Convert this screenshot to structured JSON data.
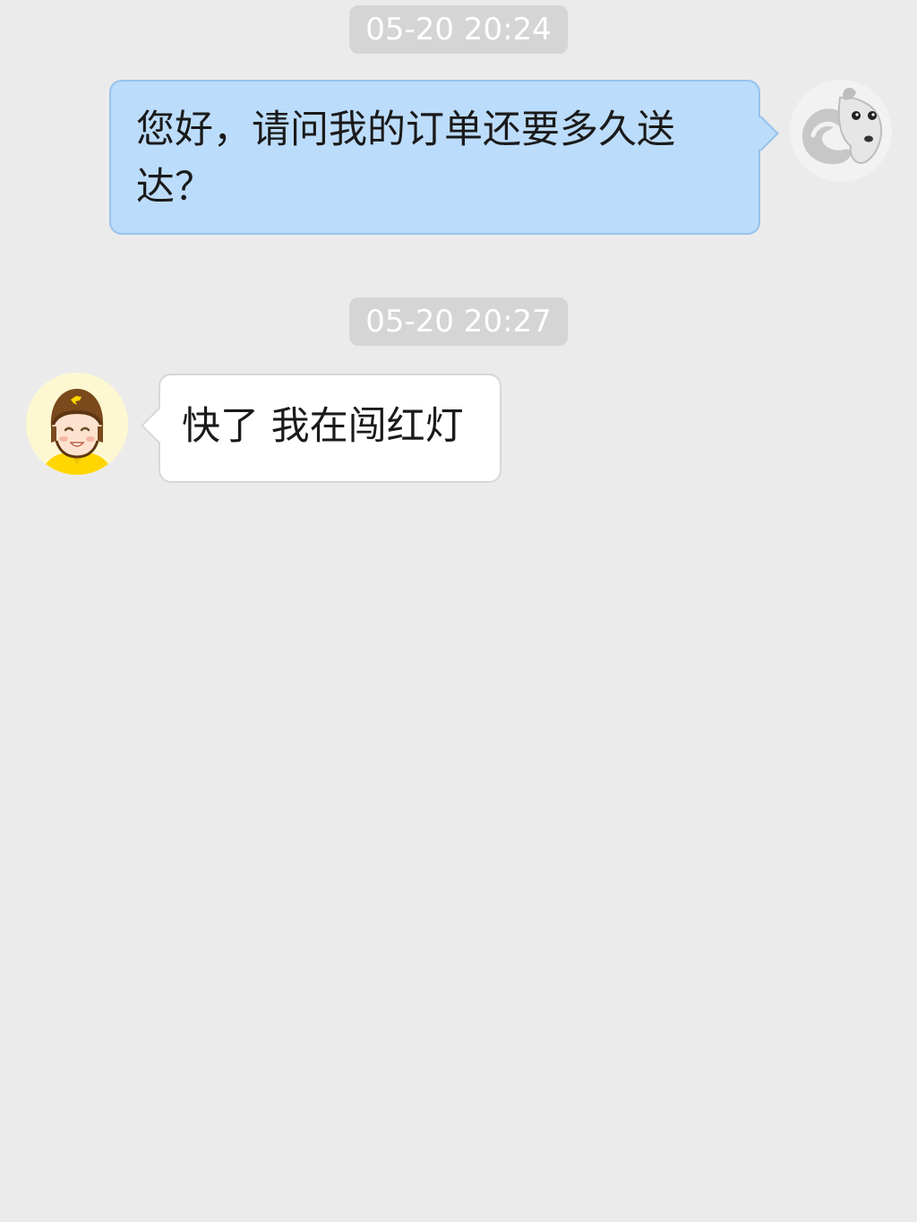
{
  "conversation": {
    "messages": [
      {
        "timestamp": "05-20 20:24",
        "sender": "self",
        "avatar_icon": "dog-cartoon-avatar-icon",
        "text": "您好，请问我的订单还要多久送达？"
      },
      {
        "timestamp": "05-20 20:27",
        "sender": "courier",
        "avatar_icon": "delivery-rider-avatar-icon",
        "text": "快了 我在闯红灯"
      }
    ]
  },
  "colors": {
    "background": "#ebebeb",
    "outgoing_bubble": "#bcdcfb",
    "incoming_bubble": "#ffffff",
    "timestamp_badge": "#d5d5d5",
    "rider_jacket": "#ffd600",
    "rider_helmet": "#7a4a1c"
  }
}
